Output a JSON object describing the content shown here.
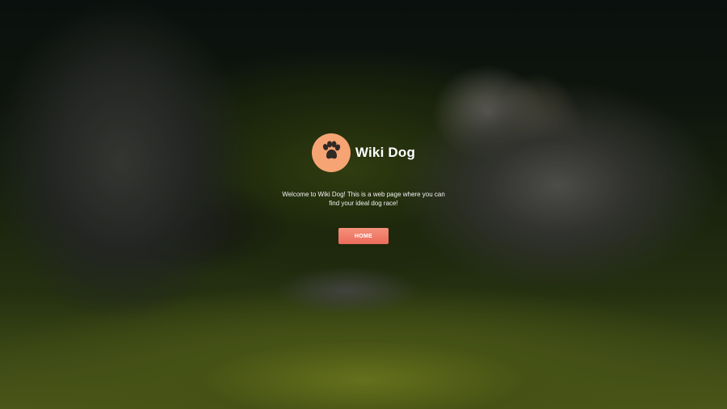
{
  "hero": {
    "brand_name": "Wiki Dog",
    "logo_icon": "paw-icon",
    "tagline": "Welcome to Wiki Dog! This is a web page where you can find your ideal dog race!",
    "home_label": "HOME"
  },
  "colors": {
    "logo_background": "#f6a474",
    "paw": "#2f2a24",
    "button_gradient_top": "#f4917a",
    "button_gradient_bottom": "#ec6b5c",
    "text": "#ffffff"
  }
}
